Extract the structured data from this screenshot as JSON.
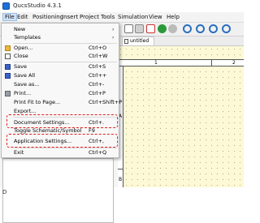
{
  "window": {
    "title": "QucsStudio 4.3.1"
  },
  "menubar": {
    "items": [
      "File",
      "Edit",
      "Positioning",
      "Insert",
      "Project",
      "Tools",
      "Simulation",
      "View",
      "Help"
    ]
  },
  "file_menu": {
    "items": [
      {
        "label": "New",
        "shortcut": "",
        "arrow": "›",
        "icon": ""
      },
      {
        "label": "Templates",
        "shortcut": "",
        "arrow": "›",
        "icon": ""
      },
      {
        "label": "Open...",
        "shortcut": "Ctrl+O",
        "arrow": "",
        "icon": "open-folder-icon"
      },
      {
        "label": "Close",
        "shortcut": "Ctrl+W",
        "arrow": "",
        "icon": "close-file-icon"
      },
      {
        "label": "Save",
        "shortcut": "Ctrl+S",
        "arrow": "",
        "icon": "save-icon"
      },
      {
        "label": "Save All",
        "shortcut": "Ctrl++",
        "arrow": "",
        "icon": "save-all-icon"
      },
      {
        "label": "Save as...",
        "shortcut": "Ctrl+-",
        "arrow": "",
        "icon": ""
      },
      {
        "label": "Print...",
        "shortcut": "Ctrl+P",
        "arrow": "",
        "icon": "printer-icon"
      },
      {
        "label": "Print Fit to Page...",
        "shortcut": "Ctrl+Shift+P",
        "arrow": "",
        "icon": ""
      },
      {
        "label": "Export...",
        "shortcut": "",
        "arrow": "",
        "icon": ""
      },
      {
        "label": "Document Settings...",
        "shortcut": "Ctrl+.",
        "arrow": "",
        "icon": ""
      },
      {
        "label": "Toggle Schematic/Symbol",
        "shortcut": "F9",
        "arrow": "",
        "icon": ""
      },
      {
        "label": "Application Settings...",
        "shortcut": "Ctrl+,",
        "arrow": "",
        "icon": ""
      },
      {
        "label": "Exit",
        "shortcut": "Ctrl+Q",
        "arrow": "",
        "icon": ""
      }
    ]
  },
  "tab": {
    "label": "untitled"
  },
  "ruler": {
    "top": [
      "1",
      "2"
    ],
    "left": [
      "A",
      "B"
    ]
  },
  "left_panel": {
    "mark": "D"
  },
  "colors": {
    "highlight": "#e02020",
    "canvas": "#fdf9d6",
    "menu_hover": "#cfe2f7"
  }
}
